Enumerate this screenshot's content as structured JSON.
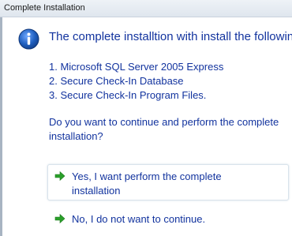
{
  "window": {
    "title": "Complete Installation"
  },
  "main": {
    "heading": "The complete installtion with install the following:",
    "items": [
      "1. Microsoft SQL Server 2005 Express",
      "2. Secure Check-In Database",
      "3. Secure Check-In Program Files."
    ],
    "question": "Do you want to continue and perform the complete installation?"
  },
  "options": {
    "yes_label": "Yes, I want perform the complete installation",
    "no_label": "No, I do not want to continue."
  },
  "colors": {
    "text_blue": "#12339e",
    "arrow_green": "#2aa02a",
    "info_blue": "#1f5fbf"
  },
  "icons": {
    "info": "info-icon",
    "command_arrow": "arrow-right-icon"
  }
}
